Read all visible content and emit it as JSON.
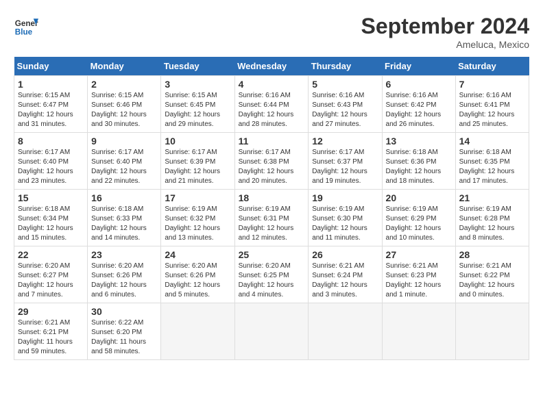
{
  "header": {
    "logo_line1": "General",
    "logo_line2": "Blue",
    "month": "September 2024",
    "location": "Ameluca, Mexico"
  },
  "weekdays": [
    "Sunday",
    "Monday",
    "Tuesday",
    "Wednesday",
    "Thursday",
    "Friday",
    "Saturday"
  ],
  "weeks": [
    [
      {
        "day": "1",
        "info": "Sunrise: 6:15 AM\nSunset: 6:47 PM\nDaylight: 12 hours\nand 31 minutes."
      },
      {
        "day": "2",
        "info": "Sunrise: 6:15 AM\nSunset: 6:46 PM\nDaylight: 12 hours\nand 30 minutes."
      },
      {
        "day": "3",
        "info": "Sunrise: 6:15 AM\nSunset: 6:45 PM\nDaylight: 12 hours\nand 29 minutes."
      },
      {
        "day": "4",
        "info": "Sunrise: 6:16 AM\nSunset: 6:44 PM\nDaylight: 12 hours\nand 28 minutes."
      },
      {
        "day": "5",
        "info": "Sunrise: 6:16 AM\nSunset: 6:43 PM\nDaylight: 12 hours\nand 27 minutes."
      },
      {
        "day": "6",
        "info": "Sunrise: 6:16 AM\nSunset: 6:42 PM\nDaylight: 12 hours\nand 26 minutes."
      },
      {
        "day": "7",
        "info": "Sunrise: 6:16 AM\nSunset: 6:41 PM\nDaylight: 12 hours\nand 25 minutes."
      }
    ],
    [
      {
        "day": "8",
        "info": "Sunrise: 6:17 AM\nSunset: 6:40 PM\nDaylight: 12 hours\nand 23 minutes."
      },
      {
        "day": "9",
        "info": "Sunrise: 6:17 AM\nSunset: 6:40 PM\nDaylight: 12 hours\nand 22 minutes."
      },
      {
        "day": "10",
        "info": "Sunrise: 6:17 AM\nSunset: 6:39 PM\nDaylight: 12 hours\nand 21 minutes."
      },
      {
        "day": "11",
        "info": "Sunrise: 6:17 AM\nSunset: 6:38 PM\nDaylight: 12 hours\nand 20 minutes."
      },
      {
        "day": "12",
        "info": "Sunrise: 6:17 AM\nSunset: 6:37 PM\nDaylight: 12 hours\nand 19 minutes."
      },
      {
        "day": "13",
        "info": "Sunrise: 6:18 AM\nSunset: 6:36 PM\nDaylight: 12 hours\nand 18 minutes."
      },
      {
        "day": "14",
        "info": "Sunrise: 6:18 AM\nSunset: 6:35 PM\nDaylight: 12 hours\nand 17 minutes."
      }
    ],
    [
      {
        "day": "15",
        "info": "Sunrise: 6:18 AM\nSunset: 6:34 PM\nDaylight: 12 hours\nand 15 minutes."
      },
      {
        "day": "16",
        "info": "Sunrise: 6:18 AM\nSunset: 6:33 PM\nDaylight: 12 hours\nand 14 minutes."
      },
      {
        "day": "17",
        "info": "Sunrise: 6:19 AM\nSunset: 6:32 PM\nDaylight: 12 hours\nand 13 minutes."
      },
      {
        "day": "18",
        "info": "Sunrise: 6:19 AM\nSunset: 6:31 PM\nDaylight: 12 hours\nand 12 minutes."
      },
      {
        "day": "19",
        "info": "Sunrise: 6:19 AM\nSunset: 6:30 PM\nDaylight: 12 hours\nand 11 minutes."
      },
      {
        "day": "20",
        "info": "Sunrise: 6:19 AM\nSunset: 6:29 PM\nDaylight: 12 hours\nand 10 minutes."
      },
      {
        "day": "21",
        "info": "Sunrise: 6:19 AM\nSunset: 6:28 PM\nDaylight: 12 hours\nand 8 minutes."
      }
    ],
    [
      {
        "day": "22",
        "info": "Sunrise: 6:20 AM\nSunset: 6:27 PM\nDaylight: 12 hours\nand 7 minutes."
      },
      {
        "day": "23",
        "info": "Sunrise: 6:20 AM\nSunset: 6:26 PM\nDaylight: 12 hours\nand 6 minutes."
      },
      {
        "day": "24",
        "info": "Sunrise: 6:20 AM\nSunset: 6:26 PM\nDaylight: 12 hours\nand 5 minutes."
      },
      {
        "day": "25",
        "info": "Sunrise: 6:20 AM\nSunset: 6:25 PM\nDaylight: 12 hours\nand 4 minutes."
      },
      {
        "day": "26",
        "info": "Sunrise: 6:21 AM\nSunset: 6:24 PM\nDaylight: 12 hours\nand 3 minutes."
      },
      {
        "day": "27",
        "info": "Sunrise: 6:21 AM\nSunset: 6:23 PM\nDaylight: 12 hours\nand 1 minute."
      },
      {
        "day": "28",
        "info": "Sunrise: 6:21 AM\nSunset: 6:22 PM\nDaylight: 12 hours\nand 0 minutes."
      }
    ],
    [
      {
        "day": "29",
        "info": "Sunrise: 6:21 AM\nSunset: 6:21 PM\nDaylight: 11 hours\nand 59 minutes."
      },
      {
        "day": "30",
        "info": "Sunrise: 6:22 AM\nSunset: 6:20 PM\nDaylight: 11 hours\nand 58 minutes."
      },
      {
        "day": "",
        "info": ""
      },
      {
        "day": "",
        "info": ""
      },
      {
        "day": "",
        "info": ""
      },
      {
        "day": "",
        "info": ""
      },
      {
        "day": "",
        "info": ""
      }
    ]
  ]
}
